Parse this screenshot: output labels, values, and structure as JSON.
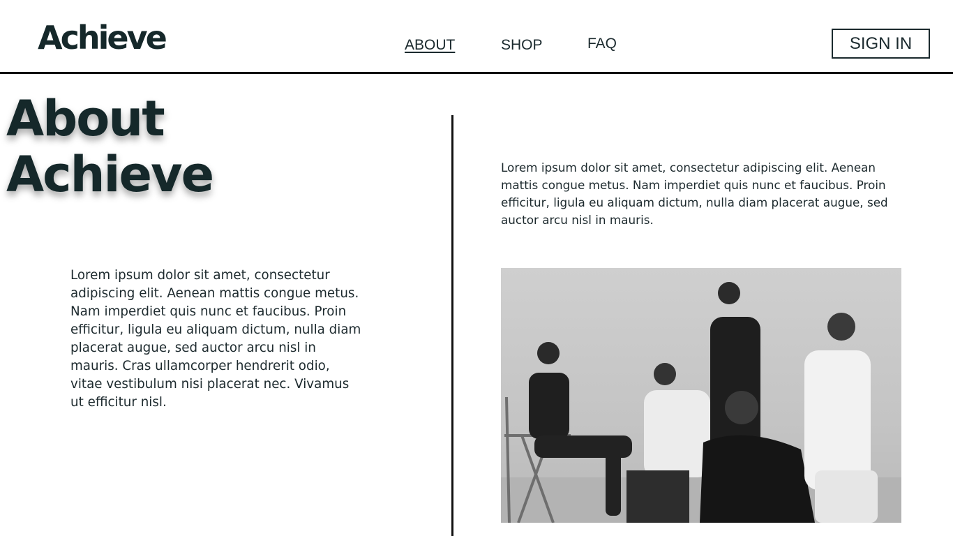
{
  "header": {
    "logo_text": "Achieve",
    "nav": [
      {
        "label": "ABOUT",
        "active": true
      },
      {
        "label": "SHOP",
        "active": false
      },
      {
        "label": "FAQ",
        "active": false
      }
    ],
    "signin_label": "SIGN IN"
  },
  "hero": {
    "title_line1": "About",
    "title_line2": "Achieve"
  },
  "left_paragraph": "Lorem ipsum dolor sit amet, consectetur adipiscing elit. Aenean mattis congue metus. Nam imperdiet quis nunc et faucibus. Proin efficitur, ligula eu aliquam dictum, nulla diam placerat augue, sed auctor arcu nisl in mauris. Cras ullamcorper hendrerit odio, vitae vestibulum nisi placerat nec. Vivamus ut efficitur nisl.",
  "right_paragraph": "Lorem ipsum dolor sit amet, consectetur adipiscing elit. Aenean mattis congue metus. Nam imperdiet quis nunc et faucibus. Proin efficitur, ligula eu aliquam dictum, nulla diam placerat augue, sed auctor arcu nisl in mauris.",
  "colors": {
    "text_dark": "#1d2a2e",
    "logo": "#15282a",
    "rule": "#111111",
    "background": "#ffffff"
  },
  "photo": {
    "style": "grayscale"
  }
}
